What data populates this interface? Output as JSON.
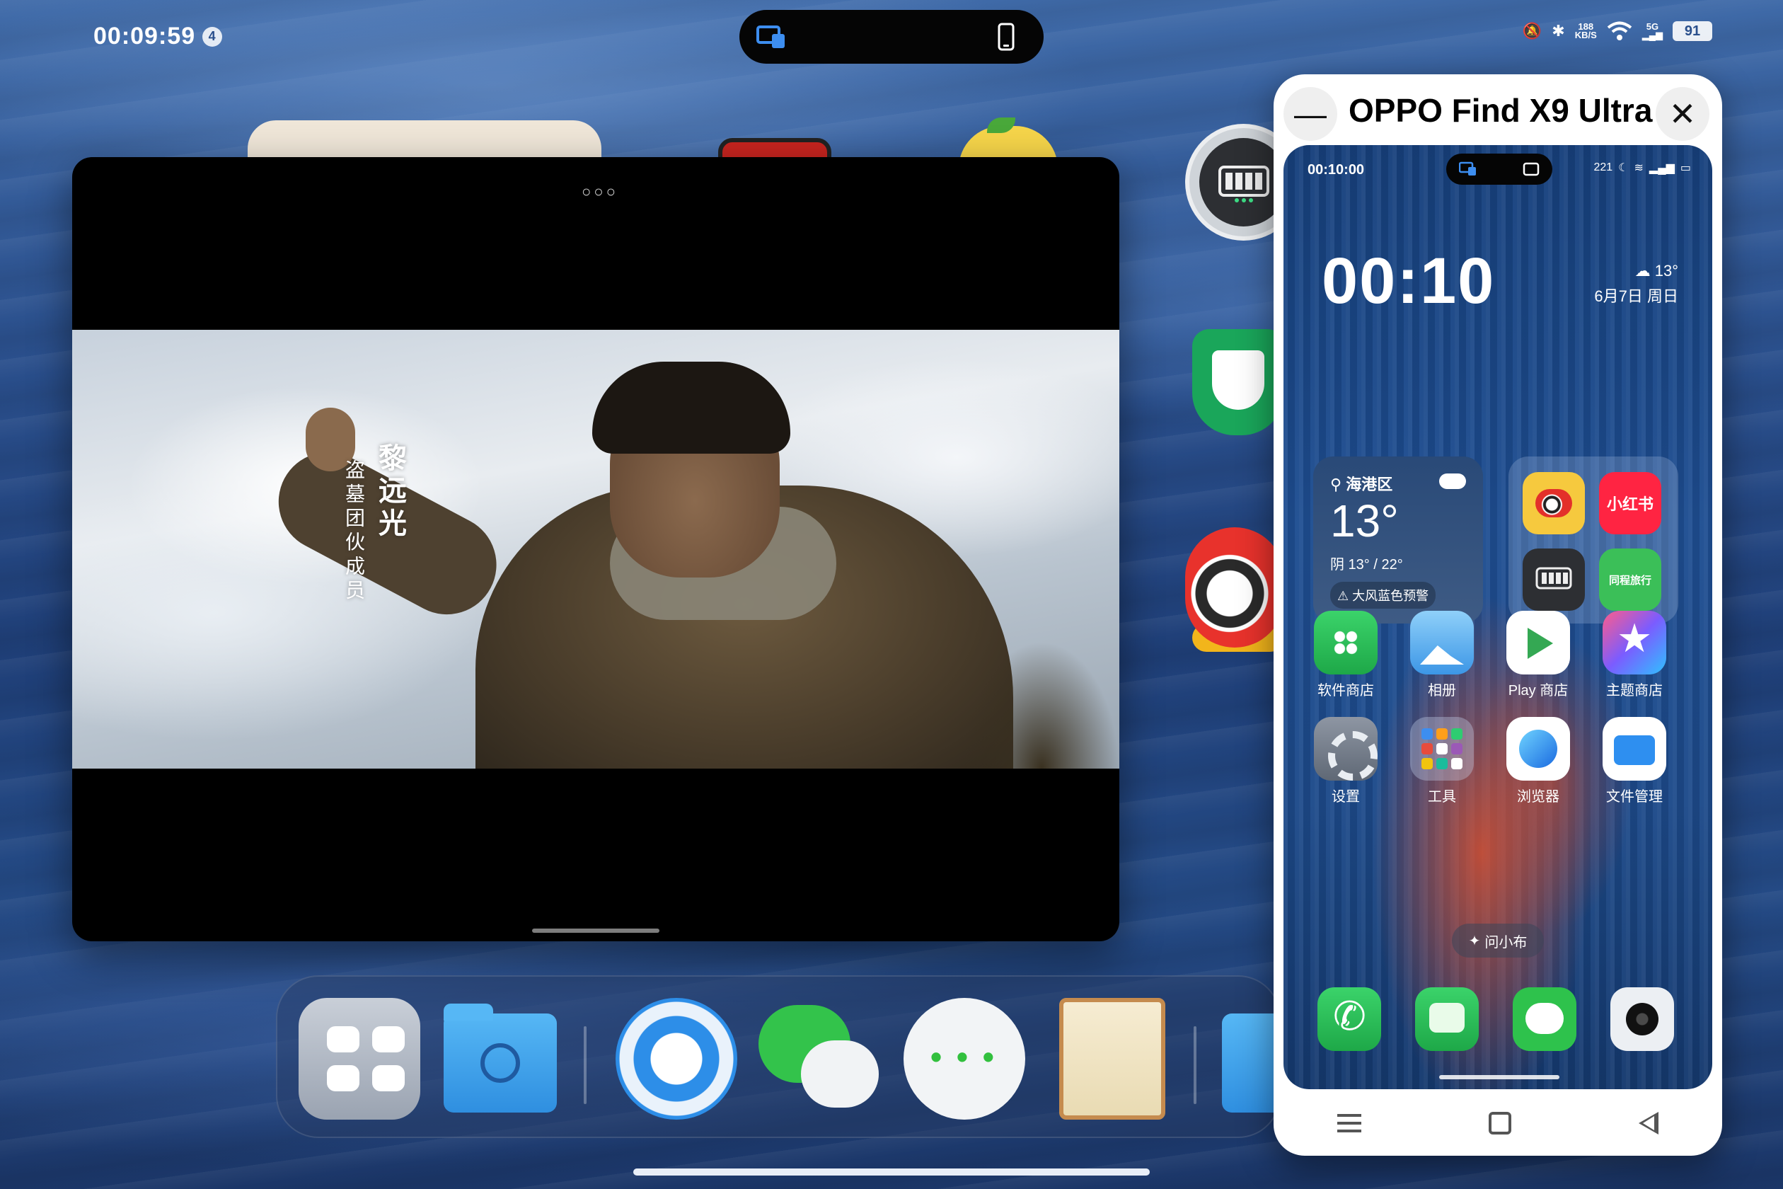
{
  "tablet_status": {
    "time": "00:09:59",
    "notif_count": "4",
    "net_speed_value": "188",
    "net_speed_unit": "KB/S",
    "signal_label": "5G",
    "battery": "91"
  },
  "video_window": {
    "menu_dots": "○○○",
    "subtitle_name": "黎远光",
    "subtitle_role": "盗墓团伙成员"
  },
  "phone_window": {
    "title": "OPPO Find X9 Ultra",
    "minimize_symbol": "—",
    "close_symbol": "✕",
    "status_time": "00:10:00",
    "status_speed": "221",
    "clock": "00:10",
    "top_weather_temp": "13°",
    "top_date": "6月7日  周日",
    "weather_widget": {
      "location": "海港区",
      "temp": "13°",
      "range": "阴 13° / 22°",
      "alert": "⚠ 大风蓝色预警"
    },
    "folder_apps": [
      "",
      "小红书",
      "",
      "同程旅行"
    ],
    "apps": [
      {
        "label": "软件商店"
      },
      {
        "label": "相册"
      },
      {
        "label": "Play 商店"
      },
      {
        "label": "主题商店"
      },
      {
        "label": "设置"
      },
      {
        "label": "工具"
      },
      {
        "label": "浏览器"
      },
      {
        "label": "文件管理"
      }
    ],
    "ask_pill": "问小布"
  },
  "icons": {
    "mirror": "screen-mirror-icon",
    "phone": "phone-outline-icon"
  }
}
